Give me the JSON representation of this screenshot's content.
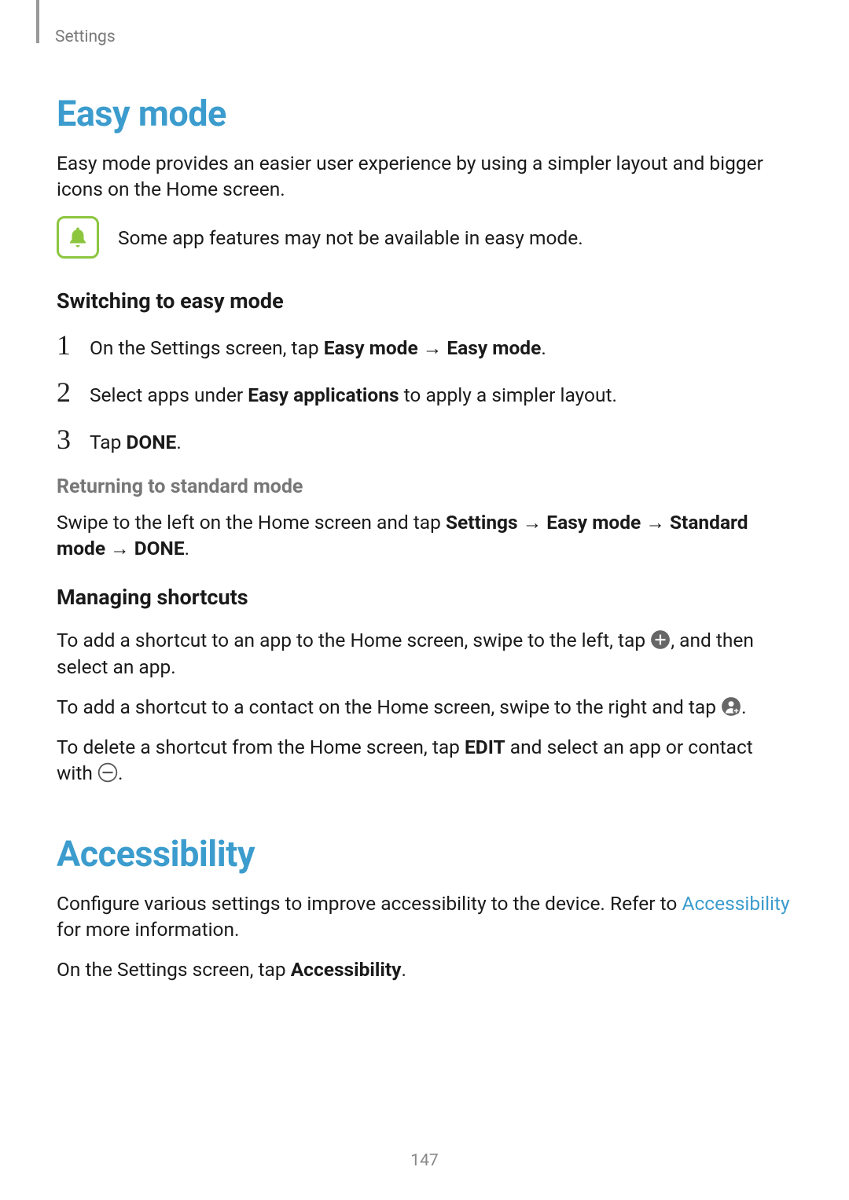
{
  "header": {
    "breadcrumb": "Settings"
  },
  "section1": {
    "title": "Easy mode",
    "intro": "Easy mode provides an easier user experience by using a simpler layout and bigger icons on the Home screen.",
    "note": "Some app features may not be available in easy mode.",
    "sub1": {
      "title": "Switching to easy mode",
      "steps": {
        "s1_a": "On the Settings screen, tap ",
        "s1_b": "Easy mode",
        "s1_arrow": " → ",
        "s1_c": "Easy mode",
        "s1_d": ".",
        "s2_a": "Select apps under ",
        "s2_b": "Easy applications",
        "s2_c": " to apply a simpler layout.",
        "s3_a": "Tap ",
        "s3_b": "DONE",
        "s3_c": "."
      },
      "returning": {
        "title": "Returning to standard mode",
        "p_a": "Swipe to the left on the Home screen and tap ",
        "p_b": "Settings",
        "p_arr1": " → ",
        "p_c": "Easy mode",
        "p_arr2": " → ",
        "p_d": "Standard mode",
        "p_arr3": " → ",
        "p_e": "DONE",
        "p_f": "."
      }
    },
    "sub2": {
      "title": "Managing shortcuts",
      "p1_a": "To add a shortcut to an app to the Home screen, swipe to the left, tap ",
      "p1_b": ", and then select an app.",
      "p2_a": "To add a shortcut to a contact on the Home screen, swipe to the right and tap ",
      "p2_b": ".",
      "p3_a": "To delete a shortcut from the Home screen, tap ",
      "p3_b": "EDIT",
      "p3_c": " and select an app or contact with ",
      "p3_d": "."
    }
  },
  "section2": {
    "title": "Accessibility",
    "p1_a": "Configure various settings to improve accessibility to the device. Refer to ",
    "p1_link": "Accessibility",
    "p1_b": " for more information.",
    "p2_a": "On the Settings screen, tap ",
    "p2_b": "Accessibility",
    "p2_c": "."
  },
  "page_number": "147",
  "numerals": {
    "n1": "1",
    "n2": "2",
    "n3": "3"
  }
}
